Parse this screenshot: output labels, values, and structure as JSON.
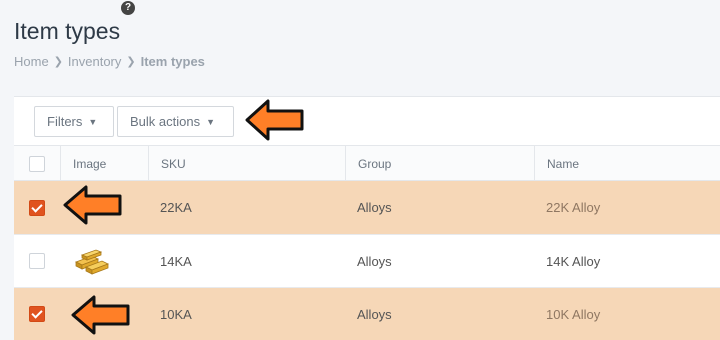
{
  "page": {
    "title": "Item types",
    "help_icon": "?"
  },
  "breadcrumb": [
    {
      "label": "Home"
    },
    {
      "label": "Inventory"
    },
    {
      "label": "Item types"
    }
  ],
  "toolbar": {
    "filters_label": "Filters",
    "bulk_label": "Bulk actions"
  },
  "table": {
    "columns": [
      "",
      "Image",
      "SKU",
      "Group",
      "Name"
    ],
    "rows": [
      {
        "checked": true,
        "image": "",
        "sku": "22KA",
        "group": "Alloys",
        "name": "22K Alloy"
      },
      {
        "checked": false,
        "image": "gold-bars-thumbnail",
        "sku": "14KA",
        "group": "Alloys",
        "name": "14K Alloy"
      },
      {
        "checked": true,
        "image": "",
        "sku": "10KA",
        "group": "Alloys",
        "name": "10K Alloy"
      }
    ]
  },
  "colors": {
    "selected_row": "#f6d7b7",
    "checkbox_checked": "#e0531f",
    "annotation_arrow": "#ff7f27"
  },
  "icons": {
    "arrow": "annotation-arrow-left-icon",
    "caret": "caret-down-icon",
    "help": "help-icon"
  }
}
